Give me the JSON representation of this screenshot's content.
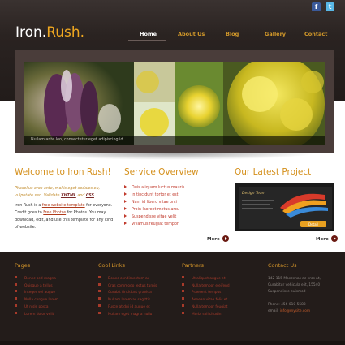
{
  "header": {
    "logo_main": "Iron.",
    "logo_accent": "Rush.",
    "social": [
      {
        "icon": "facebook-icon",
        "label": "f"
      },
      {
        "icon": "twitter-icon",
        "label": "t"
      }
    ],
    "nav": [
      {
        "label": "Home",
        "active": true
      },
      {
        "label": "About Us",
        "active": false
      },
      {
        "label": "Blog",
        "active": false
      },
      {
        "label": "Gallery",
        "active": false
      },
      {
        "label": "Contact",
        "active": false
      }
    ]
  },
  "slider": {
    "caption": "Nullam ante leo, consectetur eget adipiscing id."
  },
  "welcome": {
    "title": "Welcome to Iron Rush!",
    "italic_line1": "Phasellus eros ante, mollis eget sodales eu,",
    "italic_line2_prefix": "vulputate sed. Validate",
    "xhtml": "XHTML",
    "and": "and",
    "css": "CSS",
    "body_1": "Iron Rush is a",
    "body_link1": "free website template",
    "body_2": "for everyone.",
    "body_3": "Credit goes to",
    "body_link2": "Free Photos",
    "body_4": "for Photos. You may download, edit, and use this template for any kind of website."
  },
  "services": {
    "title": "Service Overview",
    "items": [
      "Duis aliquam luctus mauris",
      "In tincidunt tortor et est",
      "Nam id libero vitae orci",
      "Proin laoreet metus arcu",
      "Suspendisse vitae velit",
      "Vivamus feugiat tempor"
    ],
    "more": "More"
  },
  "project": {
    "title": "Our Latest Project",
    "image_title": "Design Team",
    "image_button": "Detail",
    "more": "More"
  },
  "footer": {
    "pages": {
      "title": "Pages",
      "items": [
        "Donec sed magna",
        "Quisque a tellus",
        "Integer vel augue",
        "Nulla congue lorem",
        "Ut nisle posta",
        "Lorem dolor velit"
      ]
    },
    "links": {
      "title": "Cool Links",
      "items": [
        "Donec condimentum ac",
        "Cras commodo lectus turpis",
        "Curabit tincidunt gravida",
        "Nullam lorem ac sagittis",
        "Fusce at dui id augue et",
        "Nullam eget magna nullu"
      ]
    },
    "partners": {
      "title": "Partners",
      "items": [
        "Ut aliquet augue et",
        "Nulla tempor eleifend",
        "Praesent tempus",
        "Aenean vitae felis et",
        "Nulla tempor feugiat",
        "Morbi sollicitudin"
      ]
    },
    "contact": {
      "title": "Contact Us",
      "address1": "142-115 Maecenas ac eros at,",
      "address2": "Curabitur vehicula elit, 15540",
      "address3": "Suspendisse euismod",
      "phone": "Phone: 456-010-5588",
      "email_label": "email:",
      "email": "info@mysite.com"
    }
  },
  "colors": {
    "accent": "#d48f1a",
    "header_bg": "#2c2523",
    "footer_bg": "#231c1a",
    "link_red": "#c0392b"
  }
}
